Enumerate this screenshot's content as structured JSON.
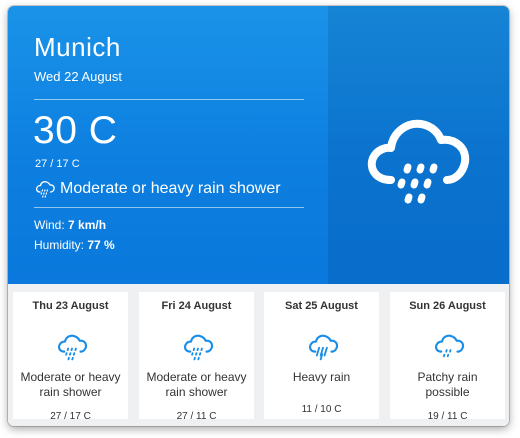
{
  "current": {
    "city": "Munich",
    "date": "Wed 22 August",
    "temperature": "30 C",
    "min_max": "27 / 17 C",
    "condition": "Moderate or heavy rain shower",
    "condition_icon": "rain-shower-cloud-icon",
    "wind_label": "Wind:",
    "wind_value": "7 km/h",
    "humidity_label": "Humidity:",
    "humidity_value": "77 %"
  },
  "forecast": [
    {
      "day": "Thu 23 August",
      "condition_line1": "Moderate or heavy",
      "condition_line2": "rain shower",
      "temps": "27 / 17 C",
      "icon": "rain-shower-cloud-icon"
    },
    {
      "day": "Fri 24 August",
      "condition_line1": "Moderate or heavy",
      "condition_line2": "rain shower",
      "temps": "27 / 11 C",
      "icon": "rain-shower-cloud-icon"
    },
    {
      "day": "Sat 25 August",
      "condition_line1": "Heavy rain",
      "condition_line2": "",
      "temps": "11 / 10 C",
      "icon": "heavy-rain-cloud-icon"
    },
    {
      "day": "Sun 26 August",
      "condition_line1": "Patchy rain",
      "condition_line2": "possible",
      "temps": "19 / 11 C",
      "icon": "patchy-rain-cloud-icon"
    }
  ],
  "colors": {
    "primary_blue": "#0d7fe0",
    "icon_blue": "#1a8ee6",
    "card_bg": "#ffffff",
    "strip_bg": "#eef0f2"
  }
}
